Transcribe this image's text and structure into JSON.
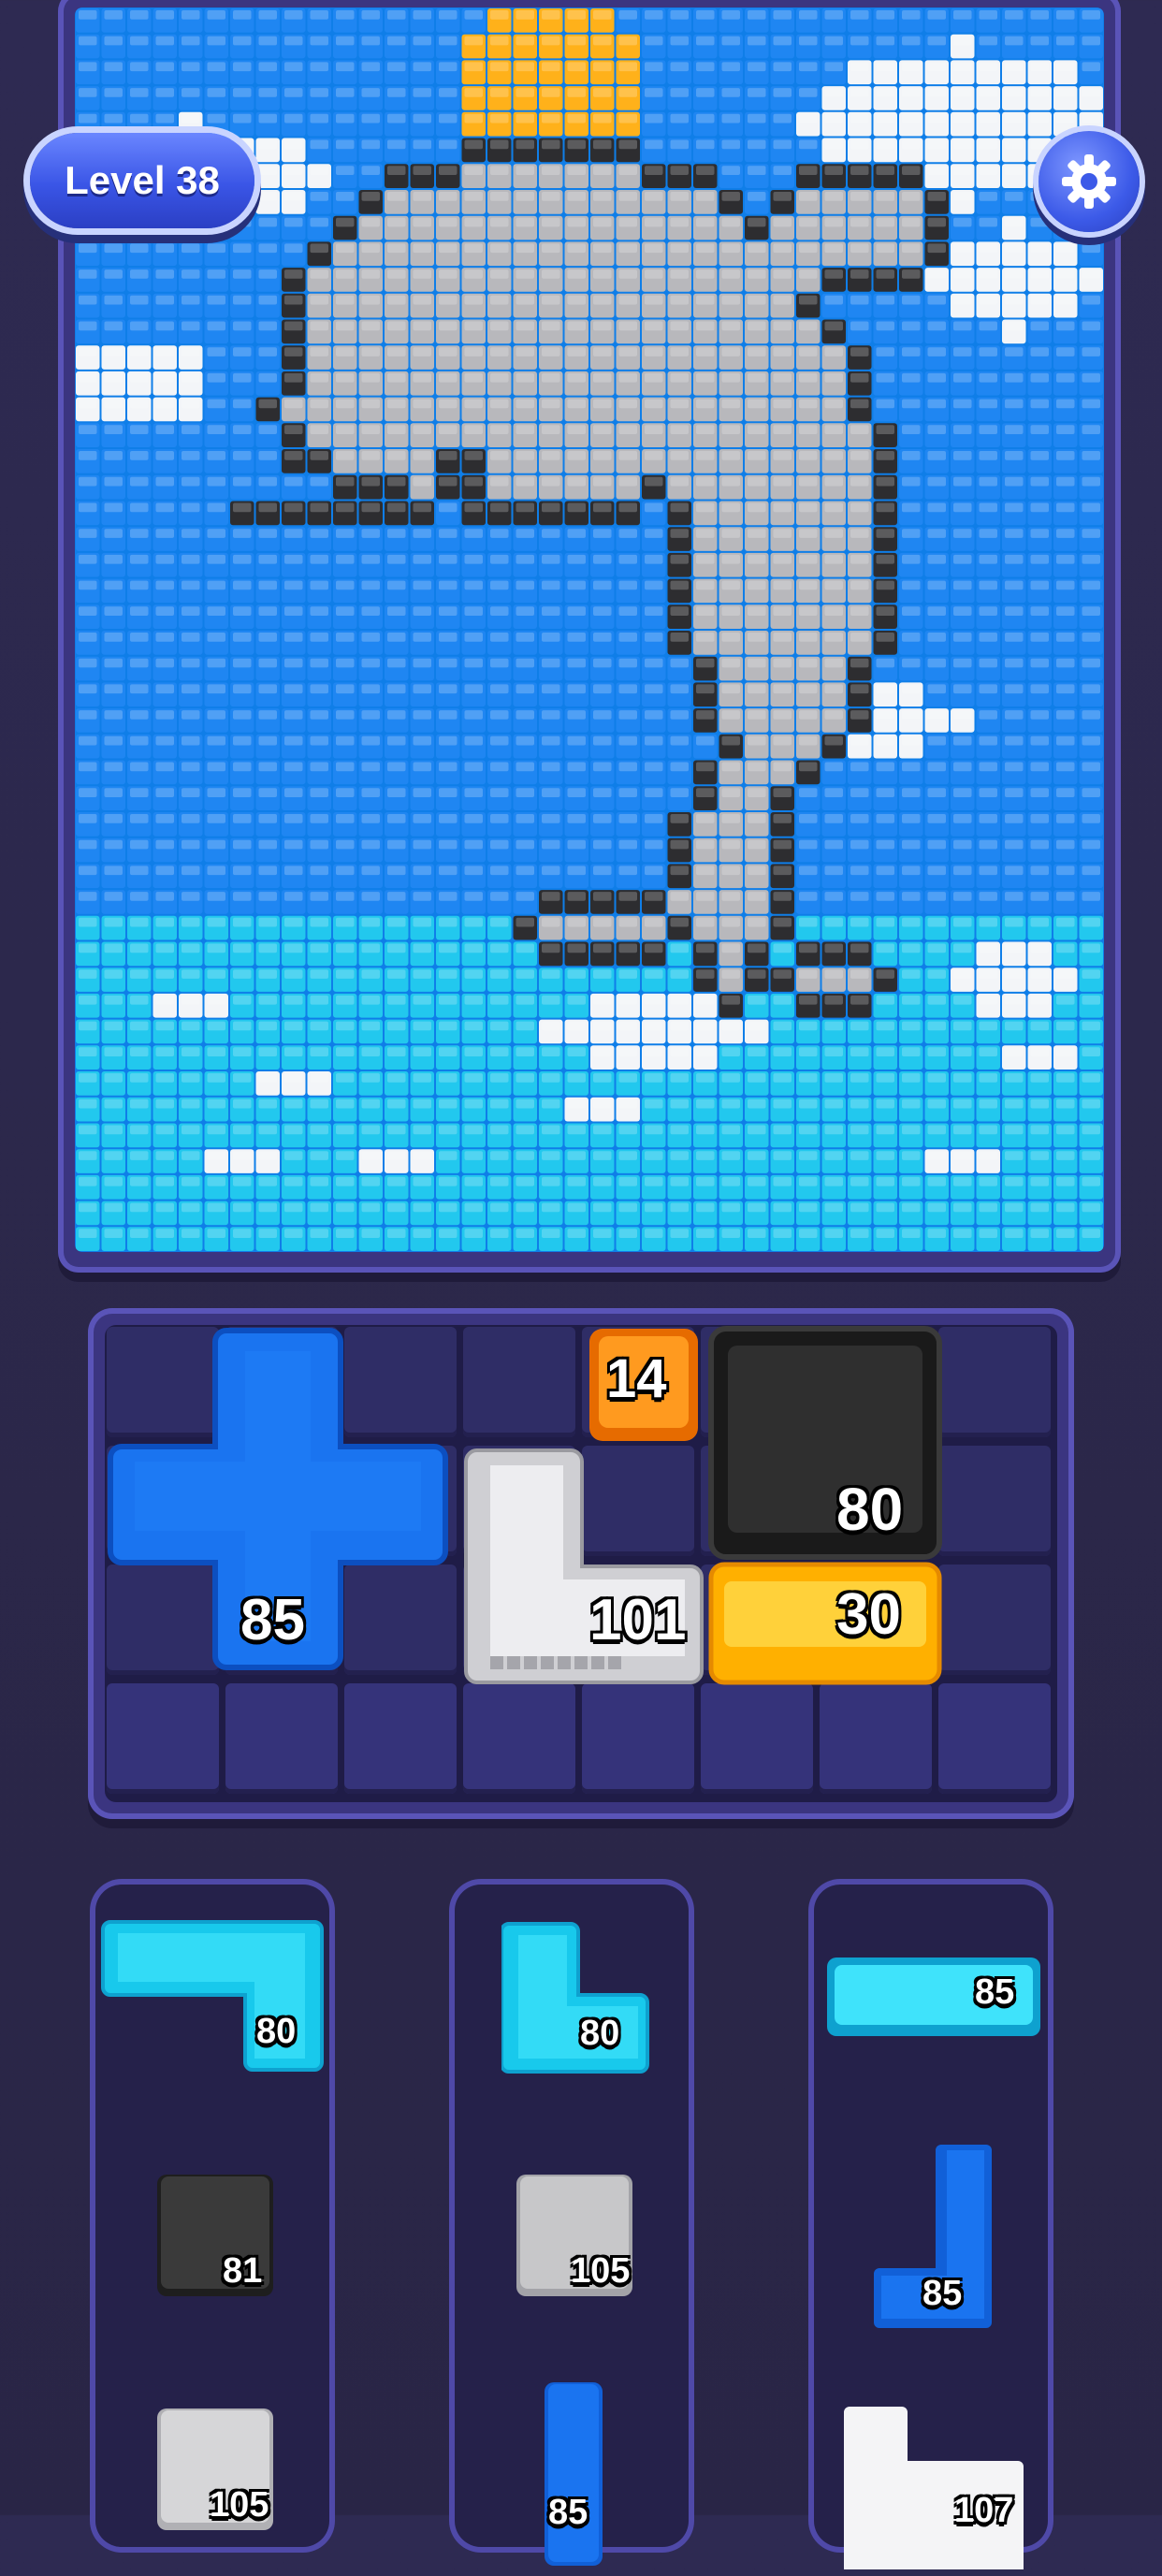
{
  "hud": {
    "level_label": "Level 38",
    "settings_icon": "gear-icon"
  },
  "picture": {
    "subject": "pixel-art-whale",
    "colors": {
      "sky": "#1f86f2",
      "sea": "#22c8ee",
      "cloud": "#f3f5f8",
      "sun": "#ffb11a",
      "whale": "#b8b8bc",
      "outline": "#2d2d30"
    }
  },
  "board": {
    "pieces": [
      {
        "id": "plus-blue",
        "color": "#1a74f0",
        "count": "85"
      },
      {
        "id": "square-orange",
        "color": "#ff8a10",
        "count": "14"
      },
      {
        "id": "block-black",
        "color": "#2b2b2b",
        "count": "80"
      },
      {
        "id": "l-white",
        "color": "#e3e3e6",
        "count": "101"
      },
      {
        "id": "bar-yellow",
        "color": "#ffc215",
        "count": "30"
      }
    ]
  },
  "trays": [
    {
      "pieces": [
        {
          "shape": "l-cyan",
          "color": "#1ed9f5",
          "count": "80"
        },
        {
          "shape": "square-black",
          "color": "#2f2f2f",
          "count": "81"
        },
        {
          "shape": "square-white",
          "color": "#d6d6d8",
          "count": "105"
        }
      ]
    },
    {
      "pieces": [
        {
          "shape": "l-cyan-small",
          "color": "#1ed9f5",
          "count": "80"
        },
        {
          "shape": "square-gray",
          "color": "#c7c7c9",
          "count": "105"
        },
        {
          "shape": "bar-blue",
          "color": "#1a74f0",
          "count": "85"
        }
      ]
    },
    {
      "pieces": [
        {
          "shape": "bar-cyan",
          "color": "#1ed9f5",
          "count": "85"
        },
        {
          "shape": "l-blue",
          "color": "#1a74f0",
          "count": "85"
        },
        {
          "shape": "l-white-partial",
          "color": "#f4f4f6",
          "count": "107"
        }
      ]
    }
  ]
}
